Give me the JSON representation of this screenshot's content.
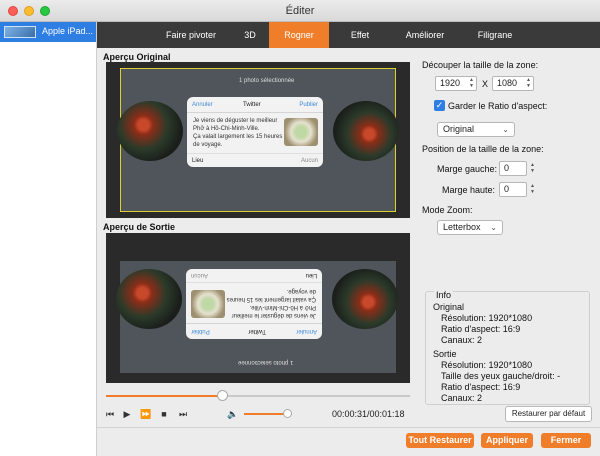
{
  "window": {
    "title": "Éditer"
  },
  "sidebar": {
    "file_name": "Apple iPad..."
  },
  "tabs": [
    "Faire pivoter",
    "3D",
    "Rogner",
    "Effet",
    "Améliorer",
    "Filigrane"
  ],
  "active_tab": "Rogner",
  "preview": {
    "original_title": "Aperçu Original",
    "output_title": "Aperçu de Sortie",
    "screen": {
      "photos_selected": "1 photo sélectionnée",
      "cancel": "Annuler",
      "dialog_title": "Twitter",
      "publish": "Publier",
      "tweet_text": [
        "Je viens de déguster le meilleur",
        "Phở à Hồ-Chi-Minh-Ville.",
        "Ça valait largement les 15 heures",
        "de voyage."
      ],
      "location": "Lieu",
      "none": "Aucun"
    }
  },
  "player": {
    "progress": 0.38,
    "volume": 0.9,
    "time": "00:00:31/00:01:18",
    "icons": [
      "skip-back-icon",
      "play-icon",
      "fast-forward-icon",
      "stop-icon",
      "skip-forward-icon",
      "speaker-icon"
    ]
  },
  "crop": {
    "size_label": "Découper la taille de la zone:",
    "width": "1920",
    "x_label": "X",
    "height": "1080",
    "keep_ratio_label": "Garder le Ratio d'aspect:",
    "keep_ratio_checked": true,
    "ratio_option": "Original",
    "position_label": "Position de la taille de la zone:",
    "margin_left_label": "Marge gauche:",
    "margin_left": "0",
    "margin_top_label": "Marge haute:",
    "margin_top": "0",
    "zoom_label": "Mode Zoom:",
    "zoom_option": "Letterbox"
  },
  "info": {
    "legend": "Info",
    "original_heading": "Original",
    "original_lines": [
      "Résolution: 1920*1080",
      "Ratio d'aspect: 16:9",
      "Canaux: 2"
    ],
    "output_heading": "Sortie",
    "output_lines": [
      "Résolution: 1920*1080",
      "Taille des yeux gauche/droit: -",
      "Ratio d'aspect: 16:9",
      "Canaux: 2"
    ]
  },
  "buttons": {
    "reset_default": "Restaurer par défaut",
    "reset_all": "Tout Restaurer",
    "apply": "Appliquer",
    "close": "Fermer"
  },
  "colors": {
    "accent": "#f07d2a",
    "selection": "#2f7ee3",
    "tabbar": "#3a3a3a"
  }
}
